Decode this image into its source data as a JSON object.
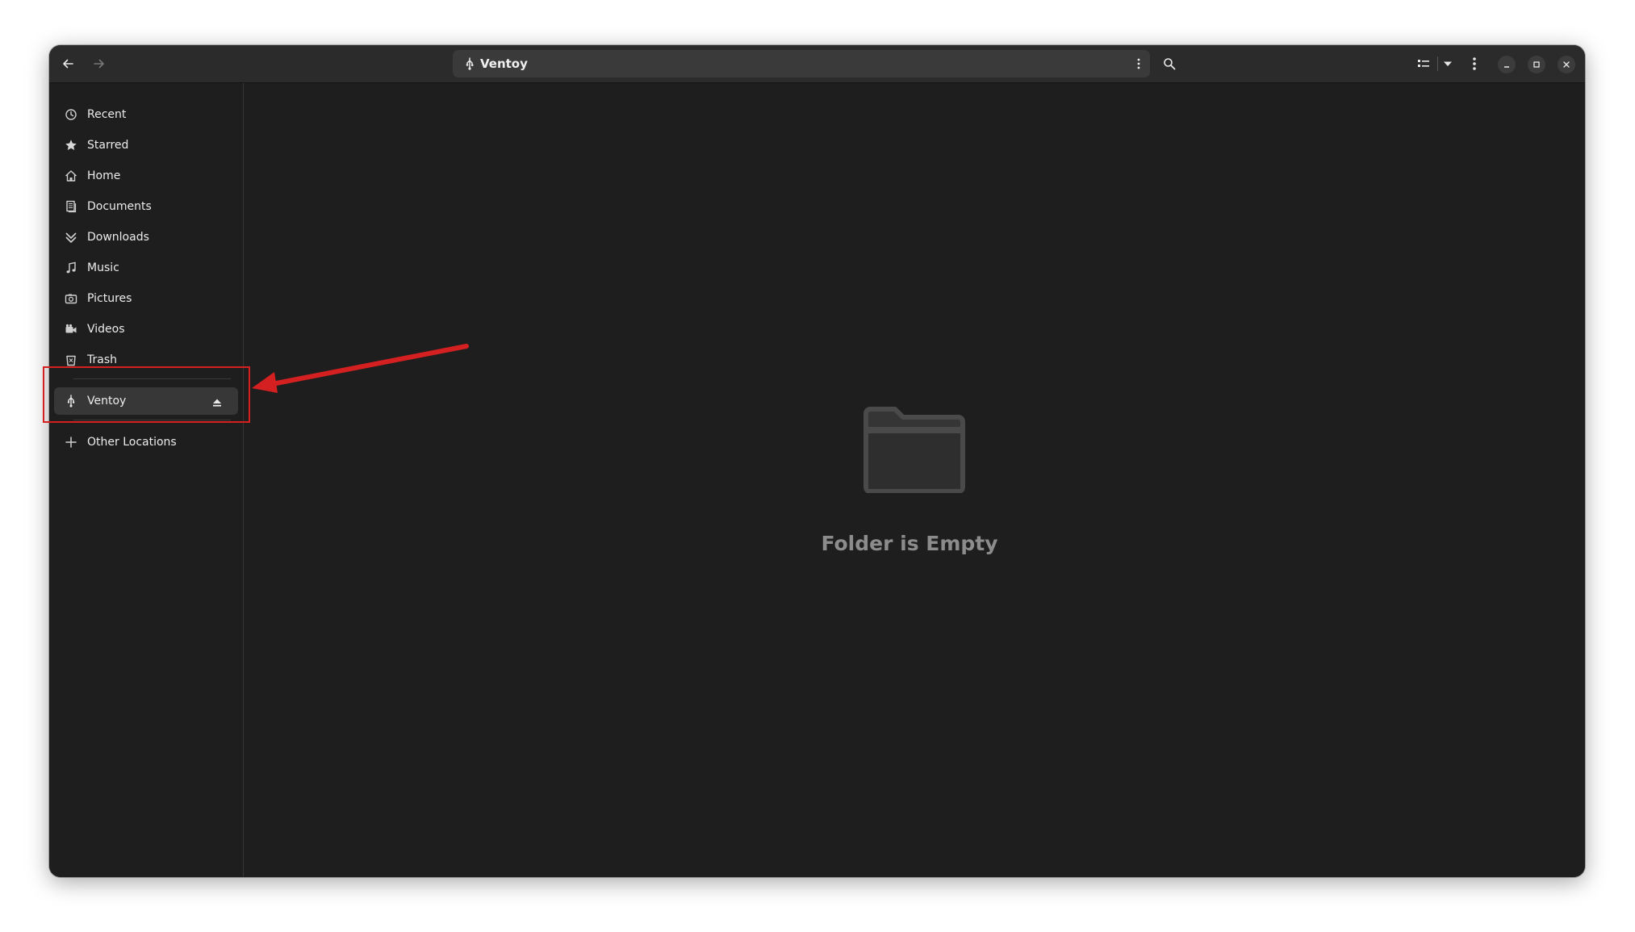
{
  "window": {
    "location_title": "Ventoy"
  },
  "sidebar": {
    "items": [
      {
        "label": "Recent",
        "icon": "clock-icon"
      },
      {
        "label": "Starred",
        "icon": "star-icon"
      },
      {
        "label": "Home",
        "icon": "home-icon"
      },
      {
        "label": "Documents",
        "icon": "documents-icon"
      },
      {
        "label": "Downloads",
        "icon": "download-icon"
      },
      {
        "label": "Music",
        "icon": "music-icon"
      },
      {
        "label": "Pictures",
        "icon": "camera-icon"
      },
      {
        "label": "Videos",
        "icon": "video-camera-icon"
      },
      {
        "label": "Trash",
        "icon": "trash-icon"
      }
    ],
    "devices": [
      {
        "label": "Ventoy",
        "icon": "usb-icon",
        "action_icon": "eject-icon",
        "selected": true
      }
    ],
    "other_locations": {
      "label": "Other Locations",
      "icon": "plus-icon"
    }
  },
  "content": {
    "empty_state_title": "Folder is Empty",
    "empty_state_icon": "folder-icon"
  },
  "annotation": {
    "color": "#d42020"
  }
}
